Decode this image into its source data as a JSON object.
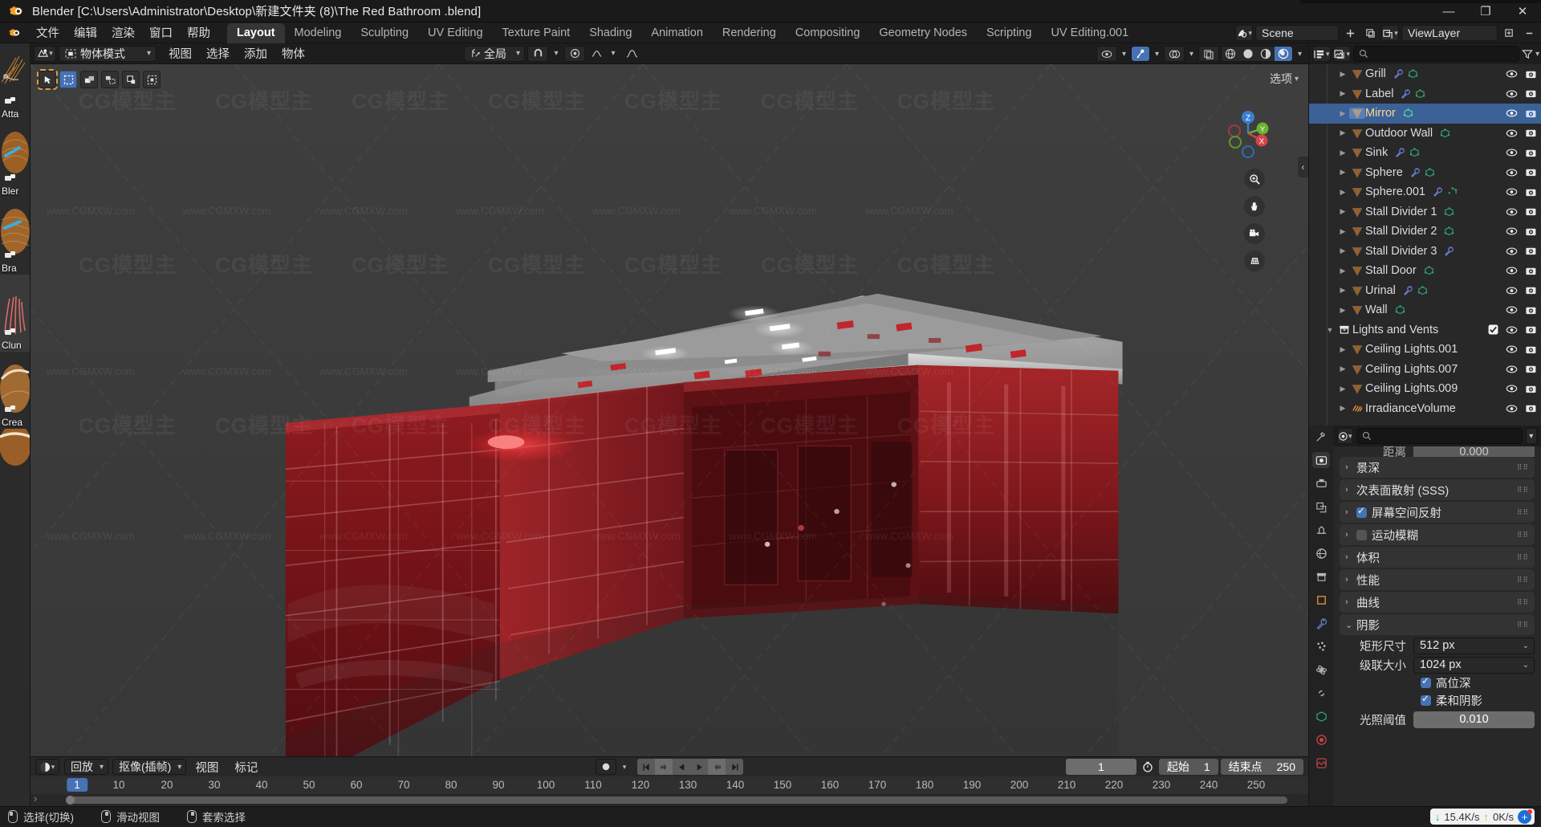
{
  "window": {
    "title": "Blender [C:\\Users\\Administrator\\Desktop\\新建文件夹 (8)\\The Red Bathroom .blend]",
    "minimize": "—",
    "maximize": "❐",
    "close": "✕"
  },
  "topbar": {
    "menus": [
      "文件",
      "编辑",
      "渲染",
      "窗口",
      "帮助"
    ],
    "workspaces": [
      {
        "label": "Layout",
        "active": true
      },
      {
        "label": "Modeling",
        "active": false
      },
      {
        "label": "Sculpting",
        "active": false
      },
      {
        "label": "UV Editing",
        "active": false
      },
      {
        "label": "Texture Paint",
        "active": false
      },
      {
        "label": "Shading",
        "active": false
      },
      {
        "label": "Animation",
        "active": false
      },
      {
        "label": "Rendering",
        "active": false
      },
      {
        "label": "Compositing",
        "active": false
      },
      {
        "label": "Geometry Nodes",
        "active": false
      },
      {
        "label": "Scripting",
        "active": false
      },
      {
        "label": "UV Editing.001",
        "active": false
      }
    ],
    "scene_name": "Scene",
    "viewlayer_name": "ViewLayer",
    "icons": [
      "scene-icon",
      "new-scene-icon",
      "copy-scene-icon",
      "viewlayer-icon",
      "add-viewlayer-icon",
      "remove-viewlayer-icon"
    ]
  },
  "viewport_header": {
    "mode": "物体模式",
    "menus": [
      "视图",
      "选择",
      "添加",
      "物体"
    ],
    "transform_orientation": "全局",
    "snap_icon": "magnet-icon",
    "proportional_icon": "proportional-edit-icon",
    "options_label": "选项"
  },
  "viewport": {
    "select_tools": [
      "tweak-tool",
      "select-box-tool",
      "select-circle-tool",
      "select-lasso-tool",
      "select-extend-tool",
      "select-dashed-tool"
    ],
    "gizmo_axes": [
      "Z",
      "Y",
      "X"
    ],
    "nav_buttons": [
      "zoom-icon",
      "pan-hand-icon",
      "camera-view-icon",
      "ortho-persp-icon"
    ],
    "sidebar_toggle": "‹"
  },
  "asset_panel": {
    "items": [
      {
        "label": "Atta",
        "selected": false
      },
      {
        "label": "Bler",
        "selected": false
      },
      {
        "label": "Bra",
        "selected": false
      },
      {
        "label": "Clun",
        "selected": true
      },
      {
        "label": "Crea",
        "selected": false
      }
    ],
    "expand_arrow": "›"
  },
  "outliner": {
    "display_mode_icon": "outliner-display-mode-icon",
    "filter_icon": "filter-icon",
    "search_placeholder": "",
    "rows": [
      {
        "name": "Grill",
        "indent": 2,
        "type": "mesh",
        "mods": [
          "wrench",
          "mesh-data"
        ],
        "partial": true
      },
      {
        "name": "Label",
        "indent": 2,
        "type": "mesh",
        "mods": [
          "wrench",
          "mesh-data"
        ]
      },
      {
        "name": "Mirror",
        "indent": 2,
        "type": "mesh",
        "mods": [
          "mesh-data"
        ],
        "selected": true
      },
      {
        "name": "Outdoor Wall",
        "indent": 2,
        "type": "mesh",
        "mods": [
          "mesh-data"
        ]
      },
      {
        "name": "Sink",
        "indent": 2,
        "type": "mesh",
        "mods": [
          "wrench",
          "mesh-data"
        ]
      },
      {
        "name": "Sphere",
        "indent": 2,
        "type": "mesh",
        "mods": [
          "wrench",
          "mesh-data"
        ]
      },
      {
        "name": "Sphere.001",
        "indent": 2,
        "type": "mesh",
        "mods": [
          "wrench",
          "mesh-data"
        ]
      },
      {
        "name": "Stall Divider 1",
        "indent": 2,
        "type": "mesh",
        "mods": [
          "mesh-data"
        ]
      },
      {
        "name": "Stall Divider 2",
        "indent": 2,
        "type": "mesh",
        "mods": [
          "mesh-data"
        ]
      },
      {
        "name": "Stall Divider 3",
        "indent": 2,
        "type": "mesh",
        "mods": [
          "wrench"
        ]
      },
      {
        "name": "Stall Door",
        "indent": 2,
        "type": "mesh",
        "mods": [
          "mesh-data"
        ]
      },
      {
        "name": "Urinal",
        "indent": 2,
        "type": "mesh",
        "mods": [
          "wrench",
          "mesh-data"
        ]
      },
      {
        "name": "Wall",
        "indent": 2,
        "type": "mesh",
        "mods": [
          "mesh-data"
        ]
      },
      {
        "name": "Lights and Vents",
        "indent": 1,
        "type": "collection",
        "mods": [],
        "checkbox": true
      },
      {
        "name": "Ceiling Lights.001",
        "indent": 2,
        "type": "mesh",
        "mods": []
      },
      {
        "name": "Ceiling Lights.007",
        "indent": 2,
        "type": "mesh",
        "mods": []
      },
      {
        "name": "Ceiling Lights.009",
        "indent": 2,
        "type": "mesh",
        "mods": []
      },
      {
        "name": "IrradianceVolume",
        "indent": 2,
        "type": "irradiance",
        "mods": []
      }
    ],
    "visibility_icons": [
      "eye-icon",
      "camera-render-icon"
    ]
  },
  "properties": {
    "tabs": [
      "tool-icon",
      "render-icon",
      "output-icon",
      "viewlayer-icon",
      "scene-icon",
      "world-icon",
      "collection-icon",
      "object-icon",
      "modifier-icon",
      "particles-icon",
      "physics-icon",
      "constraint-icon",
      "data-icon",
      "material-icon",
      "texture-icon"
    ],
    "active_tab_index": 1,
    "search_placeholder": "",
    "clipped_row": {
      "label": "距离",
      "value": "0.000"
    },
    "panels": [
      {
        "label": "景深",
        "open": false
      },
      {
        "label": "次表面散射 (SSS)",
        "open": false
      },
      {
        "label": "屏幕空间反射",
        "open": false,
        "checkbox": true
      },
      {
        "label": "运动模糊",
        "open": false,
        "checkbox": false
      },
      {
        "label": "体积",
        "open": false
      },
      {
        "label": "性能",
        "open": false
      },
      {
        "label": "曲线",
        "open": false
      },
      {
        "label": "阴影",
        "open": true
      }
    ],
    "shadow_panel": {
      "cube_size_label": "矩形尺寸",
      "cube_size_value": "512 px",
      "cascade_size_label": "级联大小",
      "cascade_size_value": "1024 px",
      "high_bitdepth_label": "高位深",
      "high_bitdepth_on": true,
      "soft_shadows_label": "柔和阴影",
      "soft_shadows_on": true,
      "light_threshold_label": "光照阈值",
      "light_threshold_value": "0.010"
    }
  },
  "timeline": {
    "editor_icon": "timeline-editor-icon",
    "menus": [
      "回放",
      "抠像(插帧)",
      "视图",
      "标记"
    ],
    "record_icon": "record-keyframe-icon",
    "transport": [
      "jump-start",
      "prev-keyframe",
      "play-reverse",
      "play",
      "next-keyframe",
      "jump-end"
    ],
    "current_frame": "1",
    "start_label": "起始",
    "start_value": "1",
    "end_label": "结束点",
    "end_value": "250",
    "ruler_ticks": [
      "1",
      "10",
      "20",
      "30",
      "40",
      "50",
      "60",
      "70",
      "80",
      "90",
      "100",
      "110",
      "120",
      "130",
      "140",
      "150",
      "160",
      "170",
      "180",
      "190",
      "200",
      "210",
      "220",
      "230",
      "240",
      "250"
    ],
    "playhead_frame": "1"
  },
  "statusbar": {
    "items": [
      {
        "icon": "mouse-left-icon",
        "label": "选择(切换)"
      },
      {
        "icon": "mouse-middle-icon",
        "label": "滑动视图"
      },
      {
        "icon": "mouse-right-icon",
        "label": "套索选择"
      }
    ],
    "network": {
      "down": "15.4K/s",
      "up": "0K/s",
      "down_arrow": "↓",
      "up_arrow": "↑"
    }
  },
  "watermarks": {
    "big": "CG模型主",
    "small": "www.CGMXW.com"
  },
  "colors": {
    "accent_blue": "#4772b3",
    "selected_row": "#3b6196",
    "selected_text": "#ffd792",
    "mesh_orange": "#e8913c",
    "mesh_green": "#2faa72",
    "modifier_blue": "#6a7ccf",
    "bg_editor": "#282828",
    "bg_header": "#1d1d1d",
    "viewport_bg": "#3b3b3b",
    "model_red": "#8e1b1e"
  }
}
